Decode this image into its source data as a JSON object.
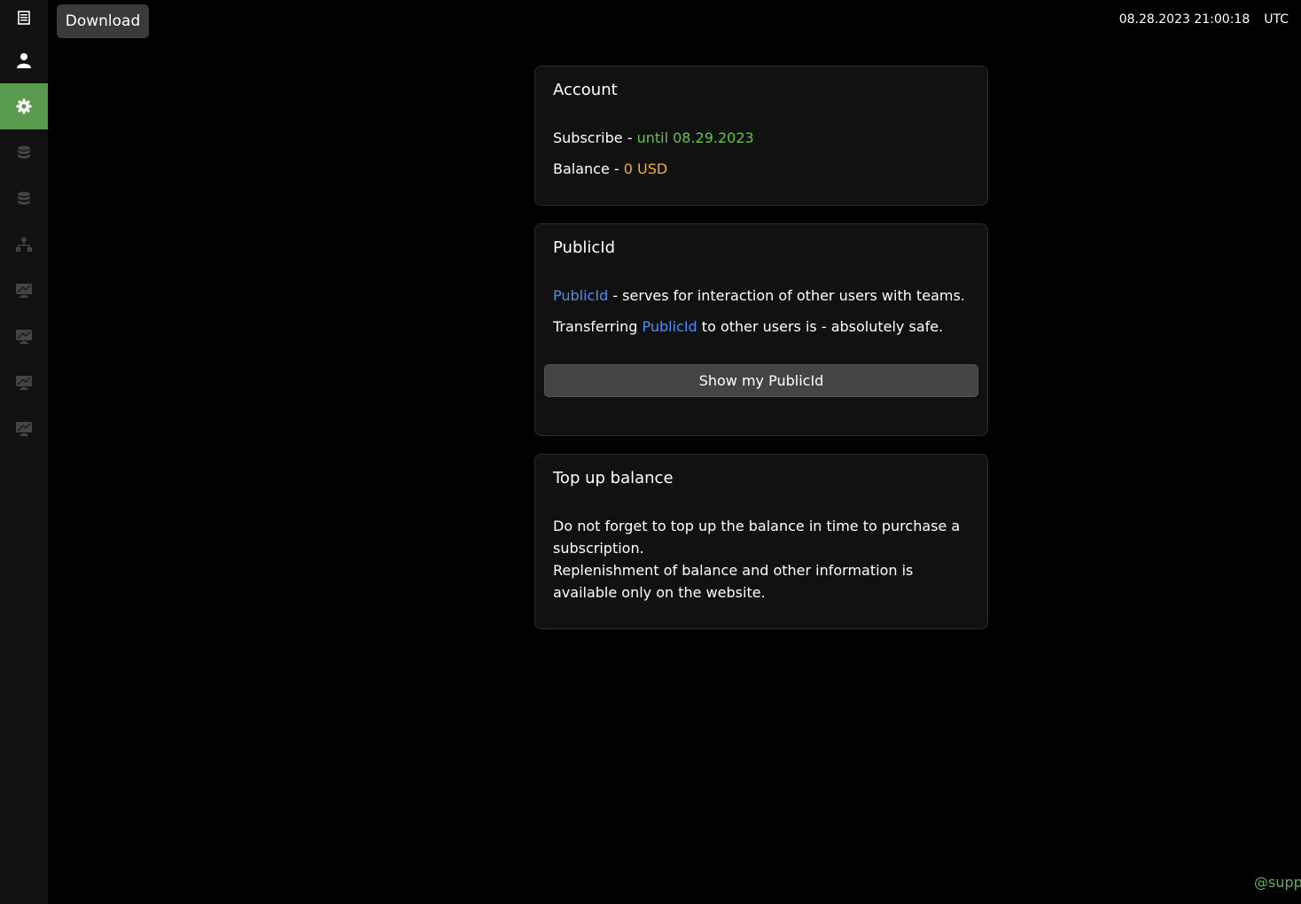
{
  "sidebar": {
    "items": [
      {
        "icon": "document-icon",
        "active": false
      },
      {
        "icon": "user-icon",
        "active": false
      },
      {
        "icon": "gear-icon",
        "active": true
      },
      {
        "icon": "database-icon",
        "active": false
      },
      {
        "icon": "database-icon",
        "active": false
      },
      {
        "icon": "network-icon",
        "active": false
      },
      {
        "icon": "monitor-icon",
        "active": false
      },
      {
        "icon": "monitor-icon",
        "active": false
      },
      {
        "icon": "monitor-icon",
        "active": false
      },
      {
        "icon": "monitor-icon",
        "active": false
      }
    ]
  },
  "header": {
    "download_label": "Download",
    "datetime": "08.28.2023 21:00:18",
    "timezone": "UTC"
  },
  "account": {
    "title": "Account",
    "subscribe_label": "Subscribe - ",
    "subscribe_value": "until 08.29.2023",
    "balance_label": "Balance - ",
    "balance_value": "0 USD"
  },
  "publicid": {
    "title": "PublicId",
    "line1_link": "PublicId",
    "line1_text": " - serves for interaction of other users with teams.",
    "line2_prefix": "Transferring ",
    "line2_link": "PublicId",
    "line2_suffix": " to other users is - absolutely safe.",
    "button_label": "Show my PublicId"
  },
  "topup": {
    "title": "Top up balance",
    "line1": "Do not forget to top up the balance in time to purchase a subscription.",
    "line2": "Replenishment of balance and other information is available only on the website."
  },
  "footer": {
    "support_text": "@supp"
  },
  "colors": {
    "accent_green": "#5a9a4f",
    "subscribe_green": "#66c24a",
    "balance_yellow": "#f2b134",
    "link_blue": "#4d8ef5"
  }
}
